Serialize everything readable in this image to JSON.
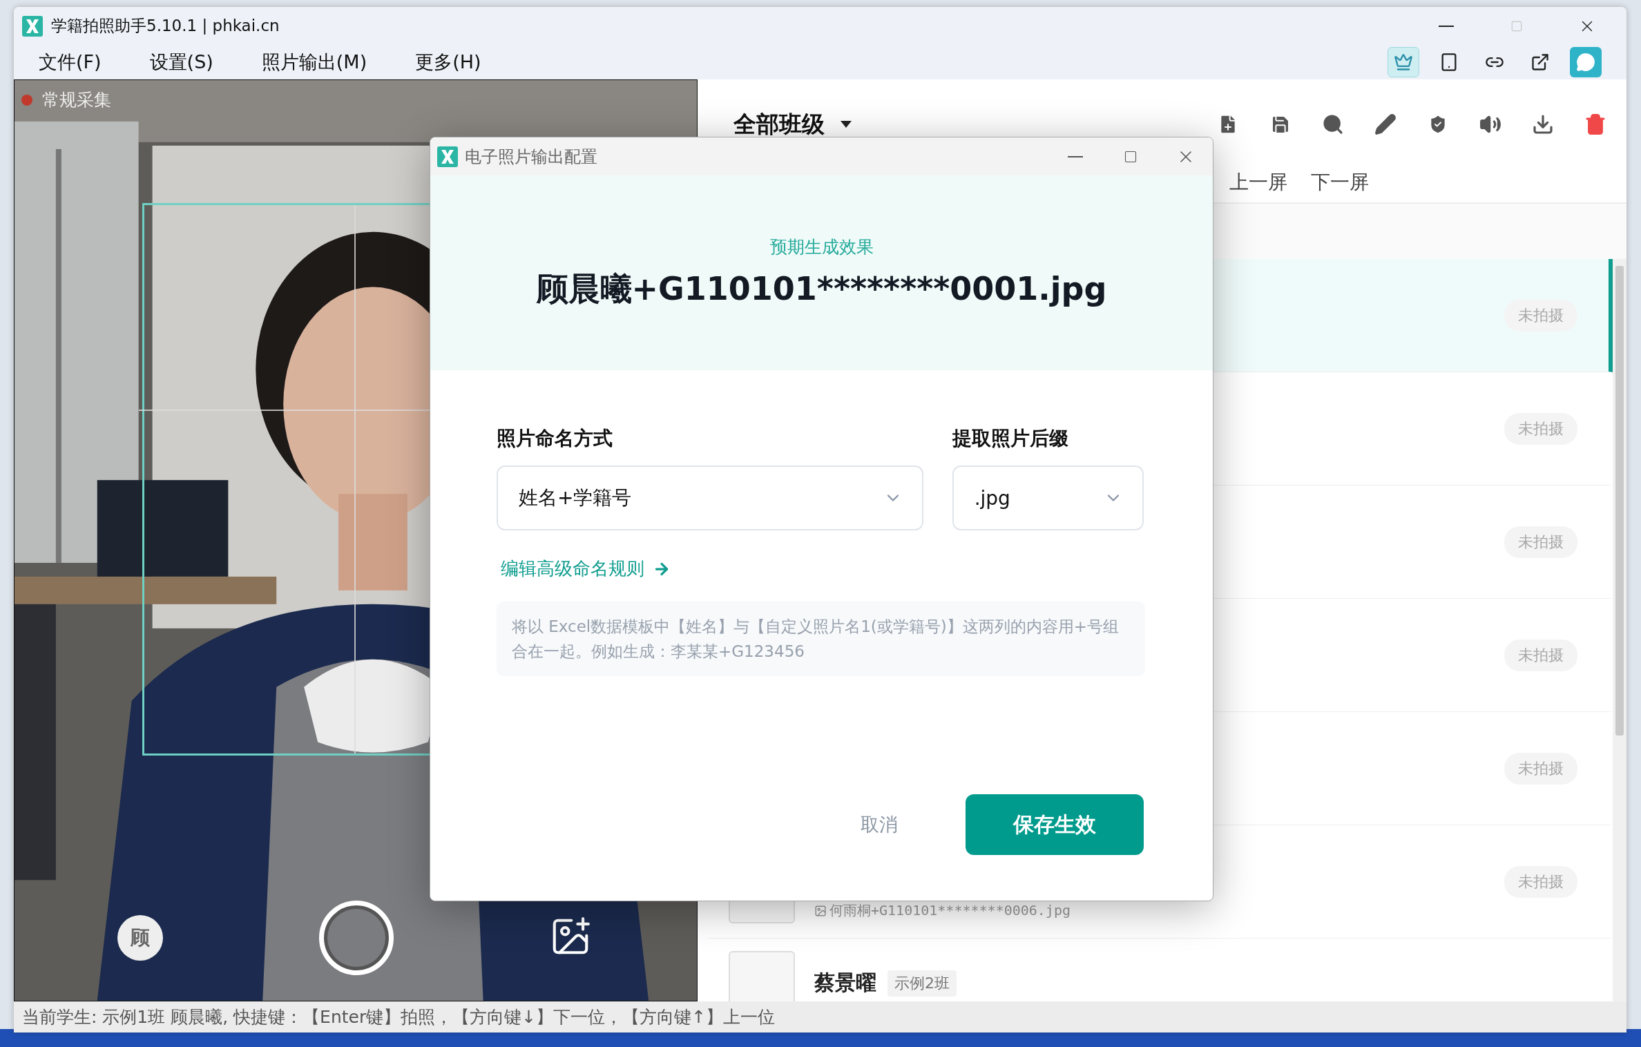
{
  "app": {
    "title": "学籍拍照助手5.10.1 | phkai.cn"
  },
  "menu": [
    {
      "label": "文件(F)"
    },
    {
      "label": "设置(S)"
    },
    {
      "label": "照片输出(M)"
    },
    {
      "label": "更多(H)"
    }
  ],
  "toolbar_icons": [
    {
      "selected": true
    },
    {
      "selected": false
    },
    {
      "selected": false
    },
    {
      "selected": false
    },
    {
      "selected": false
    }
  ],
  "camera": {
    "mode_label": "常规采集",
    "student_initial": "顾"
  },
  "class_filter": {
    "label": "全部班级"
  },
  "pager": [
    "上一屏",
    "下一屏"
  ],
  "students": [
    {
      "status": "未拍摄",
      "selected": true
    },
    {
      "status": "未拍摄",
      "selected": false
    },
    {
      "status": "未拍摄",
      "selected": false
    },
    {
      "status": "未拍摄",
      "selected": false
    },
    {
      "status": "未拍摄",
      "selected": false
    },
    {
      "filename": "何雨桐+G110101********0006.jpg",
      "status": "未拍摄",
      "selected": false
    },
    {
      "name": "蔡景曜",
      "class": "示例2班",
      "selected": false
    }
  ],
  "dialog": {
    "title": "电子照片输出配置",
    "preview_label": "预期生成效果",
    "preview_value": "顾晨曦+G110101********0001.jpg",
    "naming_label": "照片命名方式",
    "naming_value": "姓名+学籍号",
    "suffix_label": "提取照片后缀",
    "suffix_value": ".jpg",
    "advanced_link": "编辑高级命名规则",
    "note": "将以 Excel数据模板中【姓名】与【自定义照片名1(或学籍号)】这两列的内容用+号组合在一起。例如生成：李某某+G123456",
    "cancel": "取消",
    "save": "保存生效"
  },
  "status_bar": "当前学生: 示例1班 顾晨曦, 快捷键：【Enter键】拍照，【方向键↓】下一位，【方向键↑】上一位"
}
